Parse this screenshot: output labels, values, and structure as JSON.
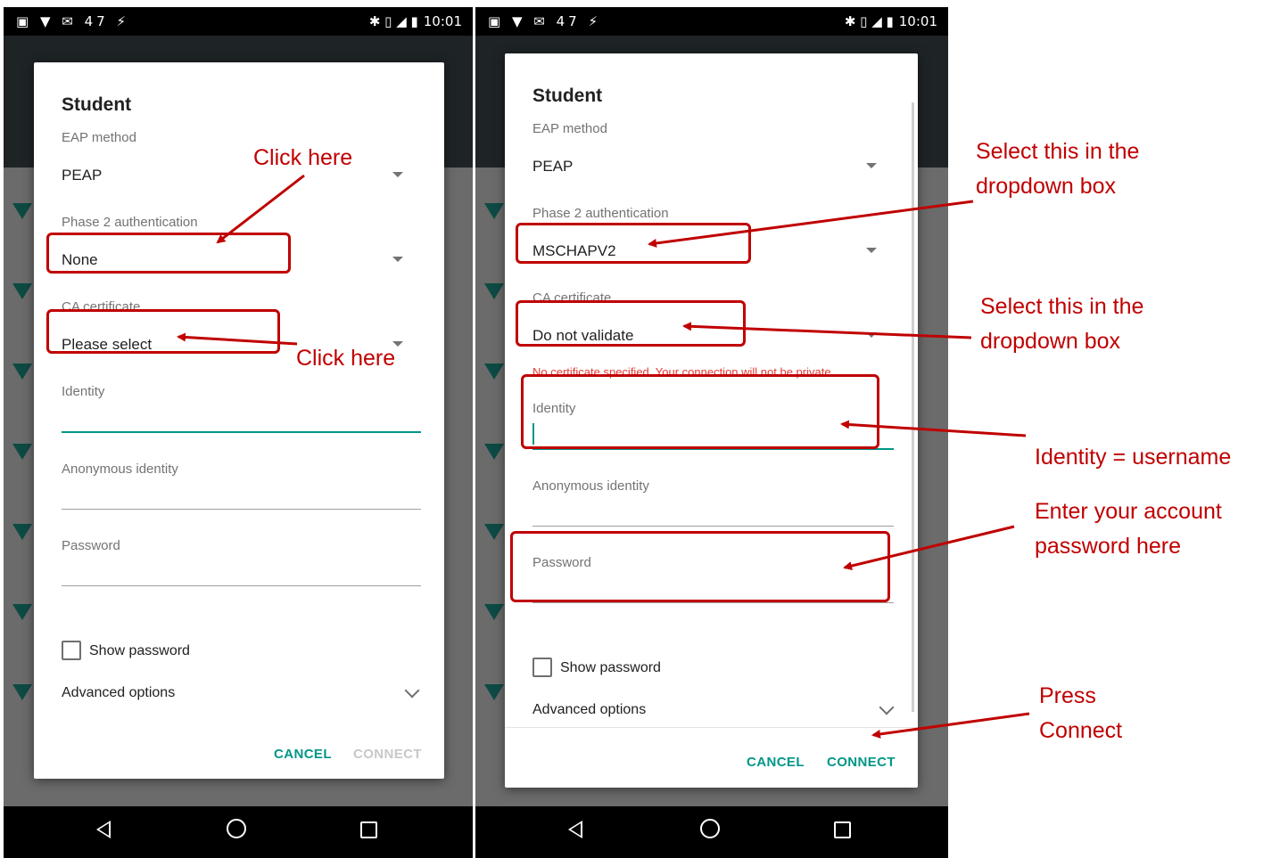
{
  "status_bar": {
    "time": "10:01",
    "notif_count": "47"
  },
  "left_dialog": {
    "title": "Student",
    "eap_label": "EAP method",
    "eap_value": "PEAP",
    "phase2_label": "Phase 2 authentication",
    "phase2_value": "None",
    "ca_label": "CA certificate",
    "ca_value": "Please select",
    "identity_label": "Identity",
    "anon_label": "Anonymous identity",
    "password_label": "Password",
    "show_password": "Show password",
    "advanced": "Advanced options",
    "cancel": "CANCEL",
    "connect": "CONNECT"
  },
  "right_dialog": {
    "title": "Student",
    "eap_label": "EAP method",
    "eap_value": "PEAP",
    "phase2_label": "Phase 2 authentication",
    "phase2_value": "MSCHAPV2",
    "ca_label": "CA certificate",
    "ca_value": "Do not validate",
    "error_text": "No certificate specified. Your connection will not be private.",
    "identity_label": "Identity",
    "anon_label": "Anonymous identity",
    "password_label": "Password",
    "show_password": "Show password",
    "advanced": "Advanced options",
    "cancel": "CANCEL",
    "connect": "CONNECT"
  },
  "annotations": {
    "click_here_1": "Click here",
    "click_here_2": "Click here",
    "select_dropdown_1a": "Select this in the",
    "select_dropdown_1b": "dropdown box",
    "select_dropdown_2a": "Select this in the",
    "select_dropdown_2b": "dropdown box",
    "identity_note": "Identity = username",
    "password_note_a": "Enter your account",
    "password_note_b": "password here",
    "press_a": "Press",
    "press_b": "Connect"
  },
  "colors": {
    "accent": "#009688",
    "annotation": "#c00000",
    "error": "#e53935"
  }
}
